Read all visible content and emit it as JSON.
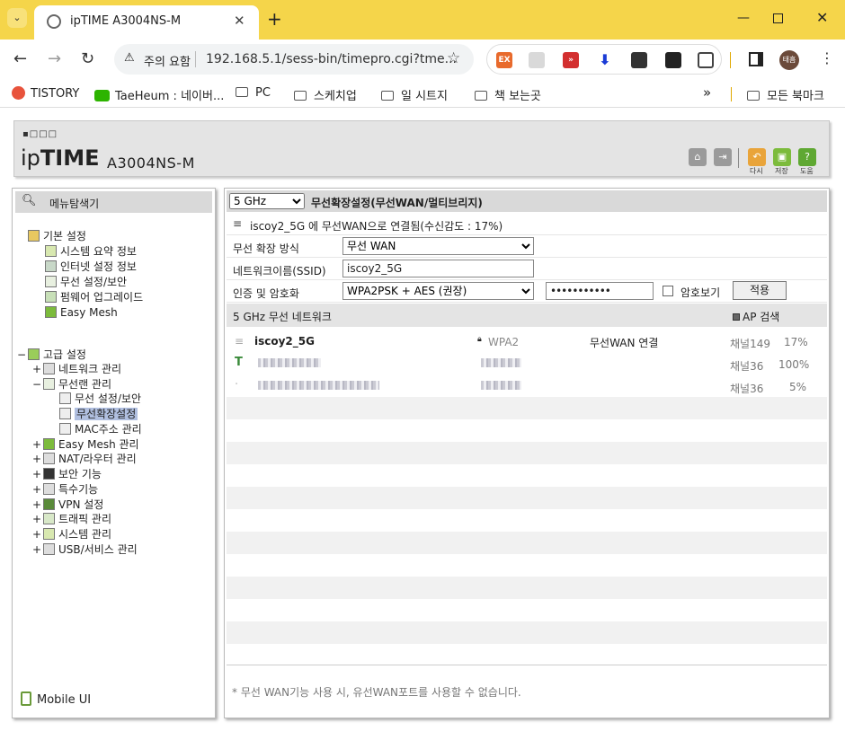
{
  "browser": {
    "tab_title": "ipTIME A3004NS-M",
    "security_label": "주의 요함",
    "url": "192.168.5.1/sess-bin/timepro.cgi?tme...",
    "profile_initial": "태흠",
    "bookmarks": [
      "TISTORY",
      "TaeHeum : 네이버...",
      "PC",
      "스케치업",
      "일 시트지",
      "책 보는곳"
    ],
    "all_bookmarks": "모든 북마크",
    "more": "»"
  },
  "header": {
    "logo_ip": "ip",
    "logo_time": "TIME",
    "model": "A3004NS-M",
    "buttons": [
      {
        "name": "home",
        "label": ""
      },
      {
        "name": "logout",
        "label": ""
      },
      {
        "name": "reload",
        "label": "다시"
      },
      {
        "name": "save",
        "label": "저장"
      },
      {
        "name": "help",
        "label": "도움"
      }
    ]
  },
  "menu": {
    "title": "메뉴탐색기",
    "basic": {
      "label": "기본 설정",
      "items": [
        "시스템 요약 정보",
        "인터넷 설정 정보",
        "무선 설정/보안",
        "펌웨어 업그레이드",
        "Easy Mesh"
      ]
    },
    "advanced": {
      "label": "고급 설정",
      "groups": [
        {
          "label": "네트워크 관리",
          "toggle": "+"
        },
        {
          "label": "무선랜 관리",
          "toggle": "−"
        },
        {
          "label": "Easy Mesh 관리",
          "toggle": "+"
        },
        {
          "label": "NAT/라우터 관리",
          "toggle": "+"
        },
        {
          "label": "보안 기능",
          "toggle": "+"
        },
        {
          "label": "특수기능",
          "toggle": "+"
        },
        {
          "label": "VPN 설정",
          "toggle": "+"
        },
        {
          "label": "트래픽 관리",
          "toggle": "+"
        },
        {
          "label": "시스템 관리",
          "toggle": "+"
        },
        {
          "label": "USB/서비스 관리",
          "toggle": "+"
        }
      ],
      "wireless_children": [
        "무선 설정/보안",
        "무선확장설정",
        "MAC주소 관리"
      ]
    },
    "mobile_ui": "Mobile UI"
  },
  "panel": {
    "band": "5 GHz",
    "title": "무선확장설정(무선WAN/멀티브리지)",
    "status": "iscoy2_5G 에 무선WAN으로 연결됨(수신감도 : 17%)",
    "mode_label": "무선 확장 방식",
    "mode_value": "무선 WAN",
    "ssid_label": "네트워크이름(SSID)",
    "ssid_value": "iscoy2_5G",
    "auth_label": "인증 및 암호화",
    "auth_value": "WPA2PSK + AES (권장)",
    "password_mask": "•••••••••••",
    "show_password": "암호보기",
    "apply": "적용",
    "network_section": "5 GHz 무선 네트워크",
    "ap_search": "AP 검색",
    "ap_list": [
      {
        "ssid": "iscoy2_5G",
        "security": "WPA2",
        "status": "무선WAN 연결",
        "channel": "채널149",
        "signal": "17%"
      },
      {
        "ssid": "",
        "security": "",
        "status": "",
        "channel": "채널36",
        "signal": "100%"
      },
      {
        "ssid": "",
        "security": "",
        "status": "",
        "channel": "채널36",
        "signal": "5%"
      }
    ],
    "footer_note": "* 무선 WAN기능 사용 시, 유선WAN포트를 사용할 수 없습니다."
  }
}
